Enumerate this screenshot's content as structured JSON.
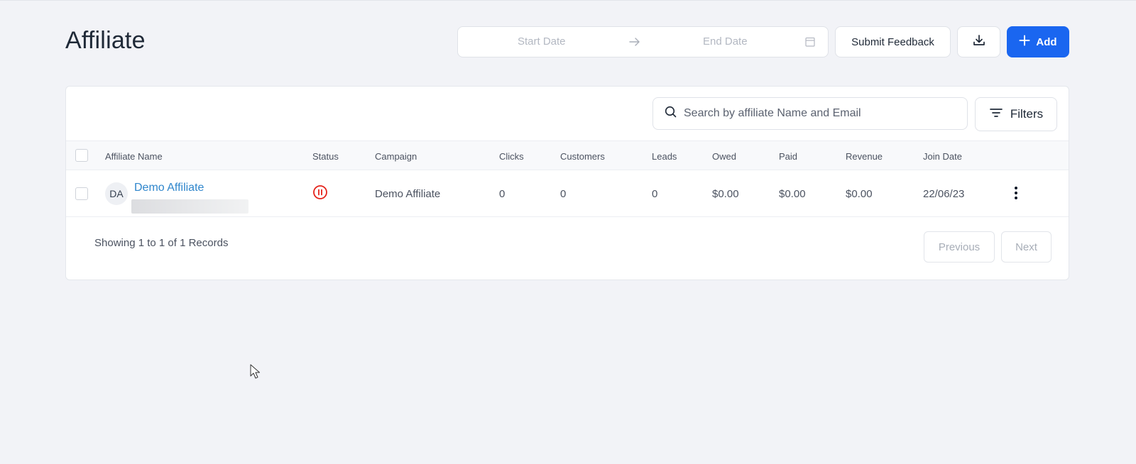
{
  "page": {
    "title": "Affiliate"
  },
  "toolbar": {
    "start_date_placeholder": "Start Date",
    "end_date_placeholder": "End Date",
    "feedback_label": "Submit Feedback",
    "add_label": "Add"
  },
  "search": {
    "placeholder": "Search by affiliate Name and Email"
  },
  "filters_label": "Filters",
  "table": {
    "columns": [
      "Affiliate Name",
      "Status",
      "Campaign",
      "Clicks",
      "Customers",
      "Leads",
      "Owed",
      "Paid",
      "Revenue",
      "Join Date"
    ],
    "rows": [
      {
        "initials": "DA",
        "name": "Demo Affiliate",
        "status": "paused",
        "campaign": "Demo Affiliate",
        "clicks": "0",
        "customers": "0",
        "leads": "0",
        "owed": "$0.00",
        "paid": "$0.00",
        "revenue": "$0.00",
        "join_date": "22/06/23"
      }
    ]
  },
  "pagination": {
    "summary": "Showing 1 to 1 of 1 Records",
    "previous_label": "Previous",
    "next_label": "Next"
  },
  "colors": {
    "primary": "#1a66f0",
    "link": "#2f86cc",
    "status_paused": "#e5231b",
    "background": "#f2f3f7"
  },
  "icons": [
    "arrow-right-icon",
    "calendar-icon",
    "download-icon",
    "plus-icon",
    "search-icon",
    "filter-icon",
    "pause-circle-icon",
    "more-vertical-icon",
    "cursor-icon"
  ]
}
